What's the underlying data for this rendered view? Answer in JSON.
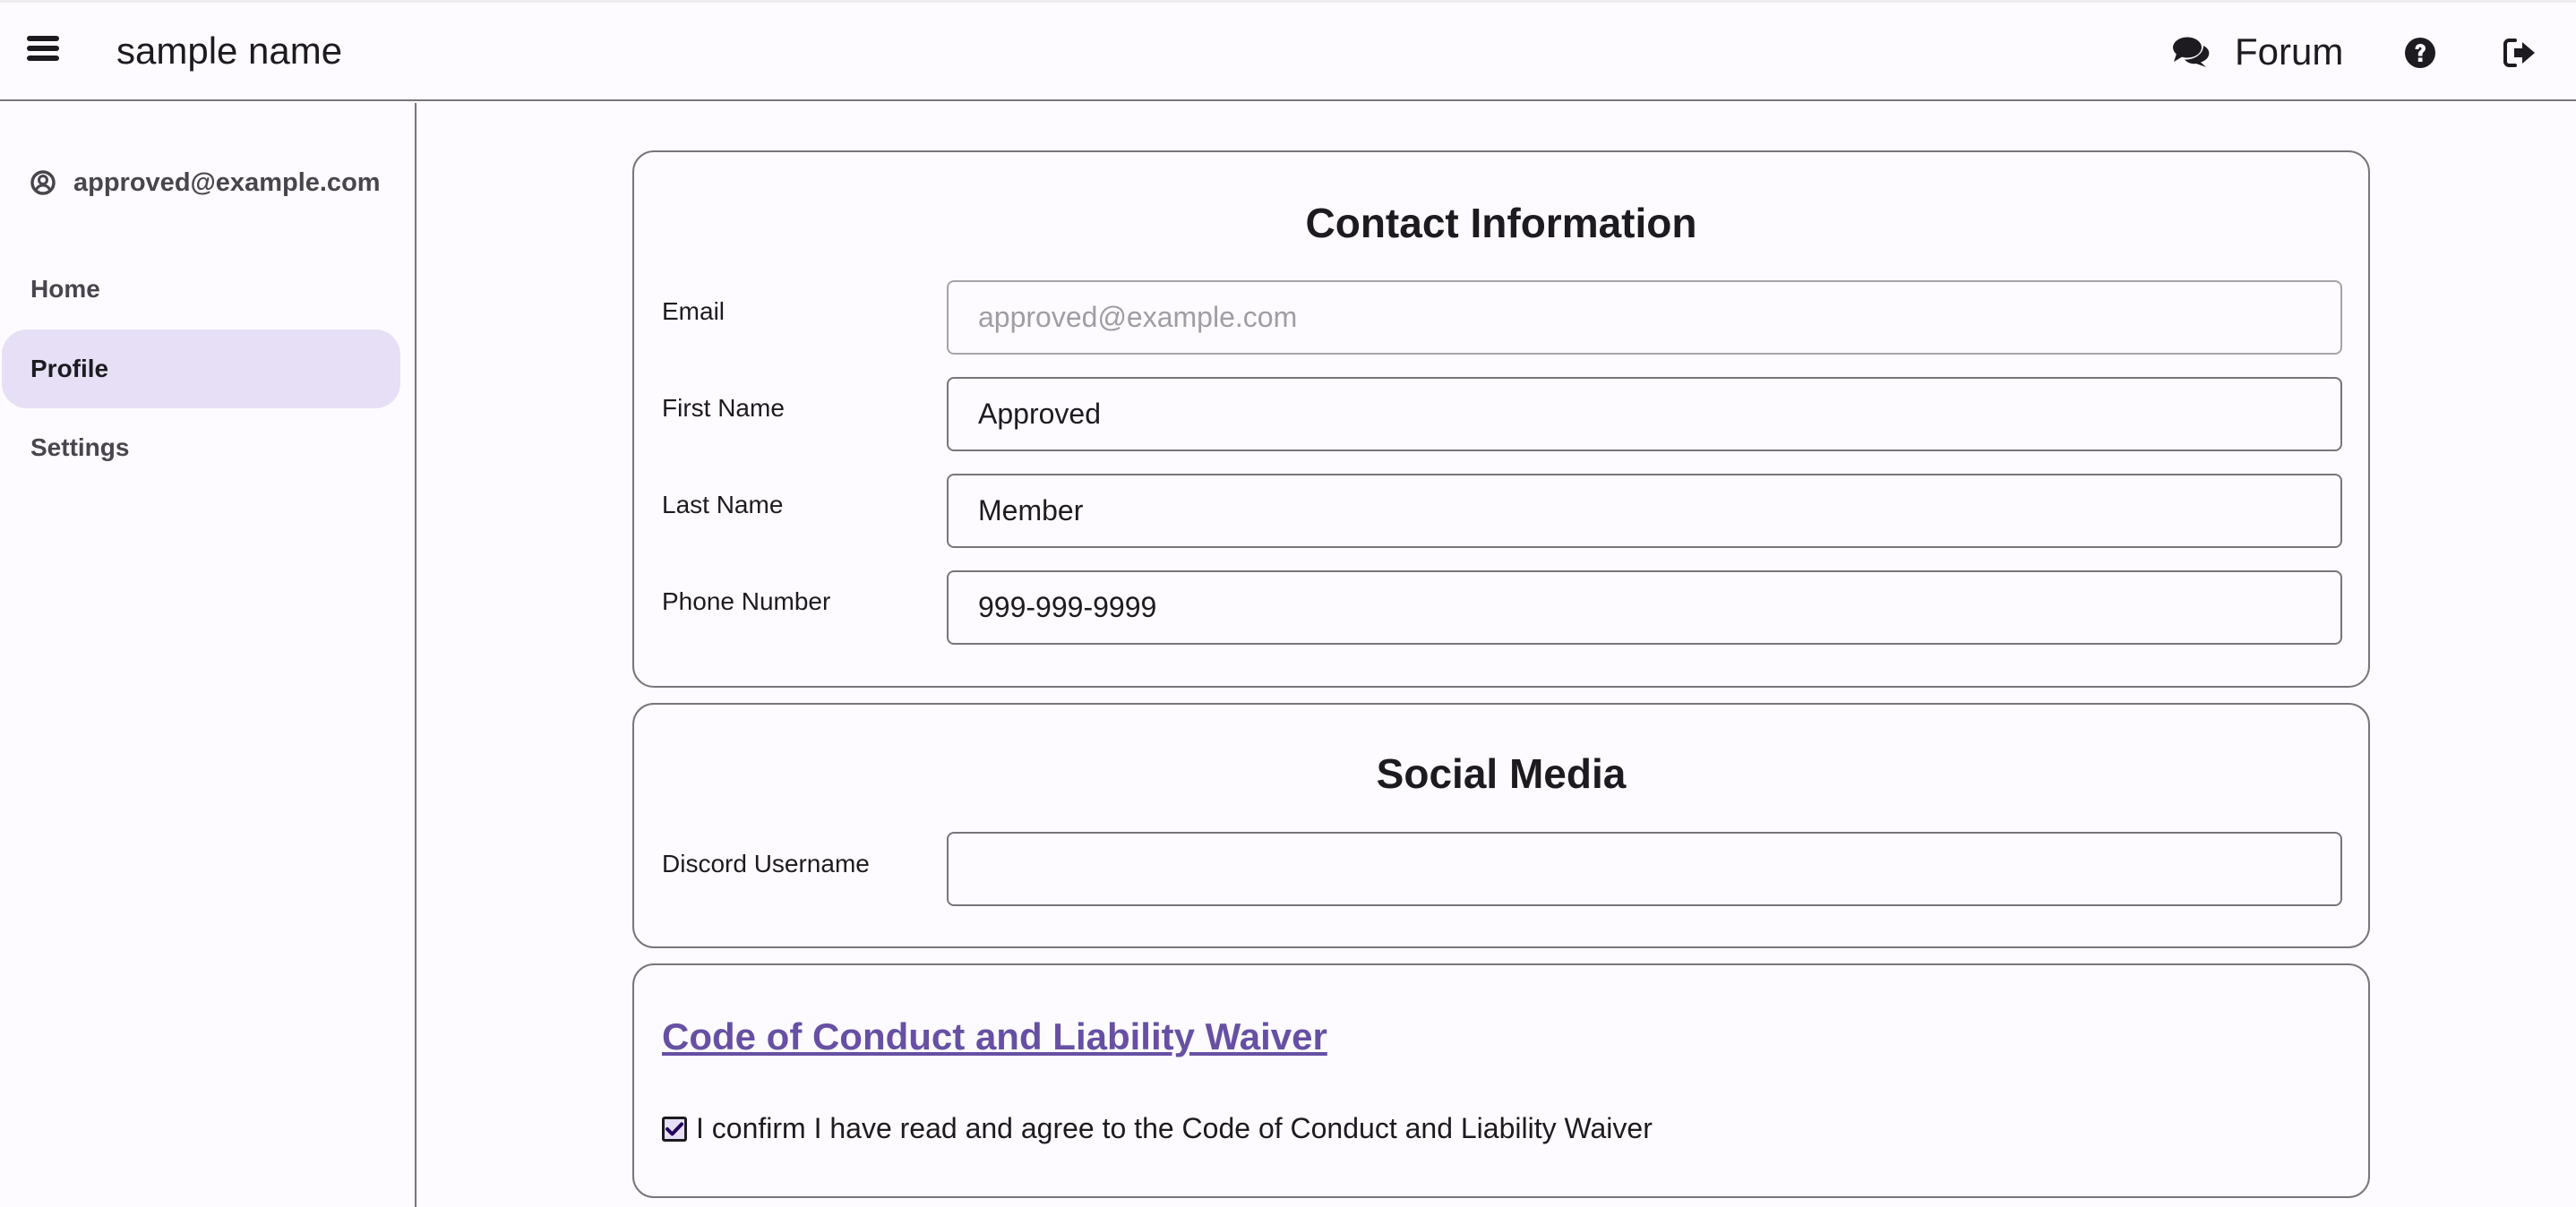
{
  "header": {
    "app_title": "sample name",
    "forum_label": "Forum",
    "icons": {
      "menu": "hamburger-menu-icon",
      "forum": "comments-icon",
      "help": "question-circle-icon",
      "logout": "sign-out-icon"
    }
  },
  "sidebar": {
    "user_email": "approved@example.com",
    "user_icon": "user-circle-icon",
    "items": [
      {
        "label": "Home",
        "active": false
      },
      {
        "label": "Profile",
        "active": true
      },
      {
        "label": "Settings",
        "active": false
      }
    ]
  },
  "contact": {
    "title": "Contact Information",
    "fields": [
      {
        "label": "Email",
        "value": "approved@example.com",
        "disabled": true
      },
      {
        "label": "First Name",
        "value": "Approved",
        "disabled": false
      },
      {
        "label": "Last Name",
        "value": "Member",
        "disabled": false
      },
      {
        "label": "Phone Number",
        "value": "999-999-9999",
        "disabled": false
      }
    ]
  },
  "social": {
    "title": "Social Media",
    "fields": [
      {
        "label": "Discord Username",
        "value": ""
      }
    ]
  },
  "waiver": {
    "link_text": "Code of Conduct and Liability Waiver",
    "confirm_label": "I confirm I have read and agree to the Code of Conduct and Liability Waiver",
    "confirmed": true
  },
  "colors": {
    "accent": "#6750A4",
    "active_nav_bg": "#E6DFF6",
    "border": "#79747E",
    "background": "#FDFBFF"
  }
}
